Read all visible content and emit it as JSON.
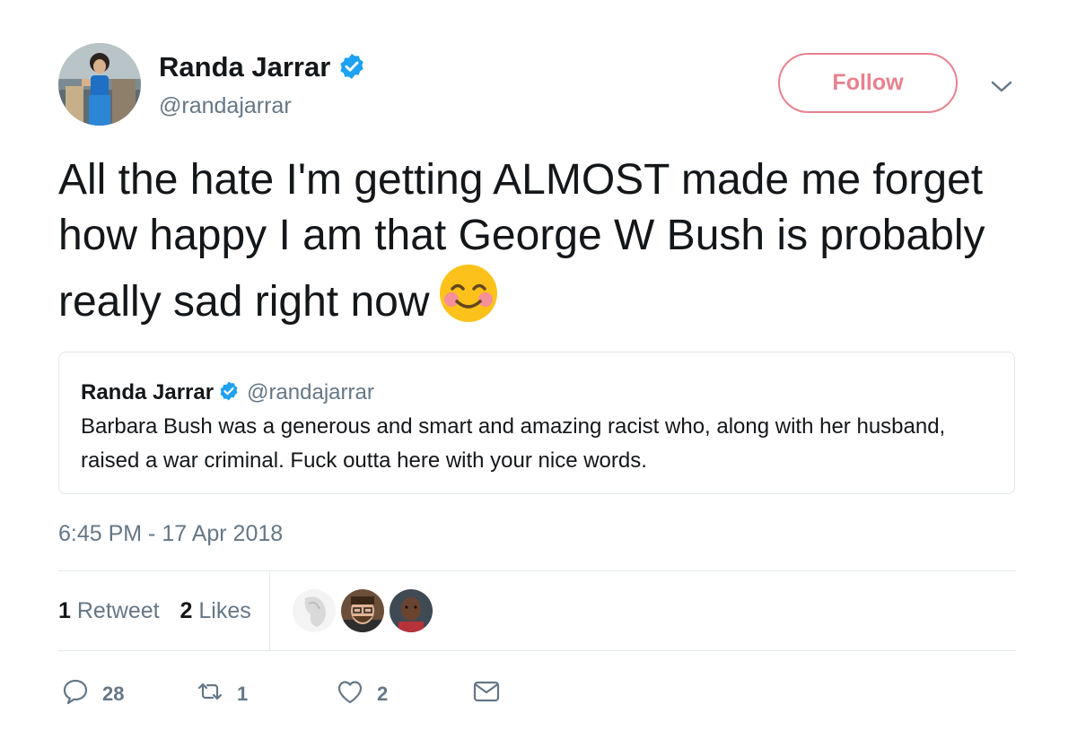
{
  "author": {
    "name": "Randa Jarrar",
    "handle": "@randajarrar",
    "verified": true
  },
  "follow_label": "Follow",
  "tweet": {
    "text": "All the hate I'm getting ALMOST made me forget how happy I am that George W Bush is probably really sad right now",
    "emoji": "smiling-face-with-blush"
  },
  "quoted": {
    "name": "Randa Jarrar",
    "handle": "@randajarrar",
    "text": "Barbara Bush was a generous and smart and amazing racist who, along with her husband, raised a war criminal. Fuck outta here with your nice words."
  },
  "timestamp": "6:45 PM - 17 Apr 2018",
  "stats": {
    "retweet_count": "1",
    "retweet_label": "Retweet",
    "like_count": "2",
    "like_label": "Likes"
  },
  "actions": {
    "reply_count": "28",
    "retweet_count": "1",
    "like_count": "2"
  },
  "colors": {
    "accent_pink": "#e8818f",
    "verified_blue": "#1da1f2",
    "secondary_text": "#657786",
    "divider": "#e1e8ed"
  },
  "icons": [
    "verified-badge-icon",
    "chevron-down-icon",
    "reply-icon",
    "retweet-icon",
    "like-icon",
    "message-icon"
  ]
}
